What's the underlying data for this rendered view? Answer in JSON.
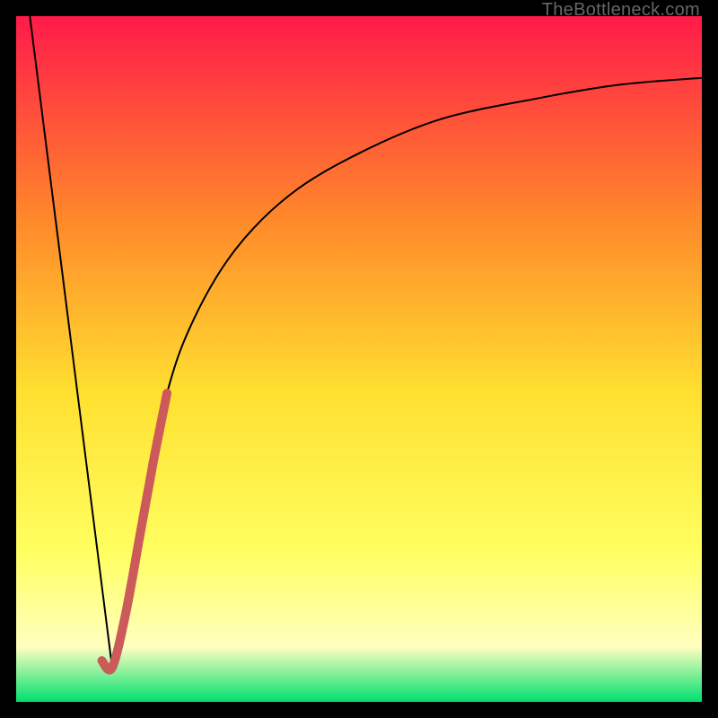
{
  "watermark": "TheBottleneck.com",
  "chart_data": {
    "type": "line",
    "title": "",
    "xlabel": "",
    "ylabel": "",
    "xlim": [
      0,
      100
    ],
    "ylim": [
      0,
      100
    ],
    "gradient_colors": {
      "top": "#ff1a4a",
      "upper_mid": "#ff8a2a",
      "mid": "#ffe030",
      "lower_mid": "#ffff60",
      "pale": "#ffffc0",
      "bottom": "#00e070"
    },
    "series": [
      {
        "name": "left-descent",
        "color": "#000000",
        "width": 2,
        "x": [
          2,
          14
        ],
        "y": [
          100,
          5
        ]
      },
      {
        "name": "right-curve",
        "color": "#000000",
        "width": 2,
        "x": [
          14,
          18,
          22,
          26,
          32,
          40,
          50,
          62,
          76,
          88,
          100
        ],
        "y": [
          5,
          26,
          45,
          56,
          66,
          74,
          80,
          85,
          88,
          90,
          91
        ]
      },
      {
        "name": "optimal-mark",
        "color": "#cc5a5a",
        "width": 10,
        "x": [
          12.5,
          14,
          16,
          18,
          20,
          22
        ],
        "y": [
          6,
          5,
          13,
          24,
          35,
          45
        ]
      }
    ]
  }
}
